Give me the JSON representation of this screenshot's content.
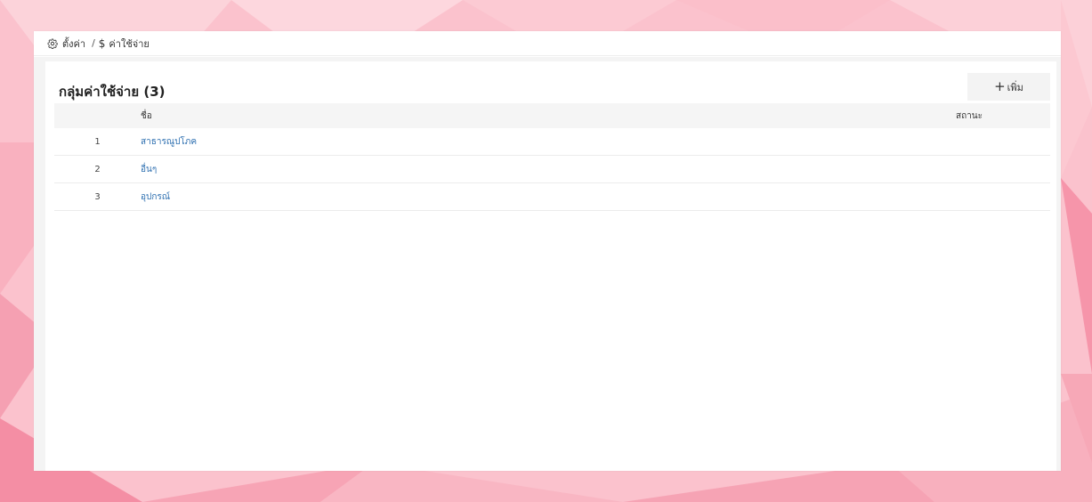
{
  "breadcrumb": {
    "settings_icon": "gear-icon",
    "settings_label": "ตั้งค่า",
    "separator": "/",
    "currency_icon": "dollar-icon",
    "currency_symbol": "$",
    "current_label": "ค่าใช้จ่าย"
  },
  "panel": {
    "title": "กลุ่มค่าใช้จ่าย (3)",
    "add_button": {
      "icon": "plus-icon",
      "icon_glyph": "+",
      "label": "เพิ่ม"
    }
  },
  "table": {
    "columns": [
      "",
      "ชื่อ",
      "สถานะ"
    ],
    "rows": [
      {
        "num": "1",
        "name": "สาธารณูปโภค",
        "status": ""
      },
      {
        "num": "2",
        "name": "อื่นๆ",
        "status": ""
      },
      {
        "num": "3",
        "name": "อุปกรณ์",
        "status": ""
      }
    ]
  },
  "colors": {
    "background": "#f9b6c4",
    "link": "#2d6fb0",
    "header_bg": "#f5f5f5"
  }
}
